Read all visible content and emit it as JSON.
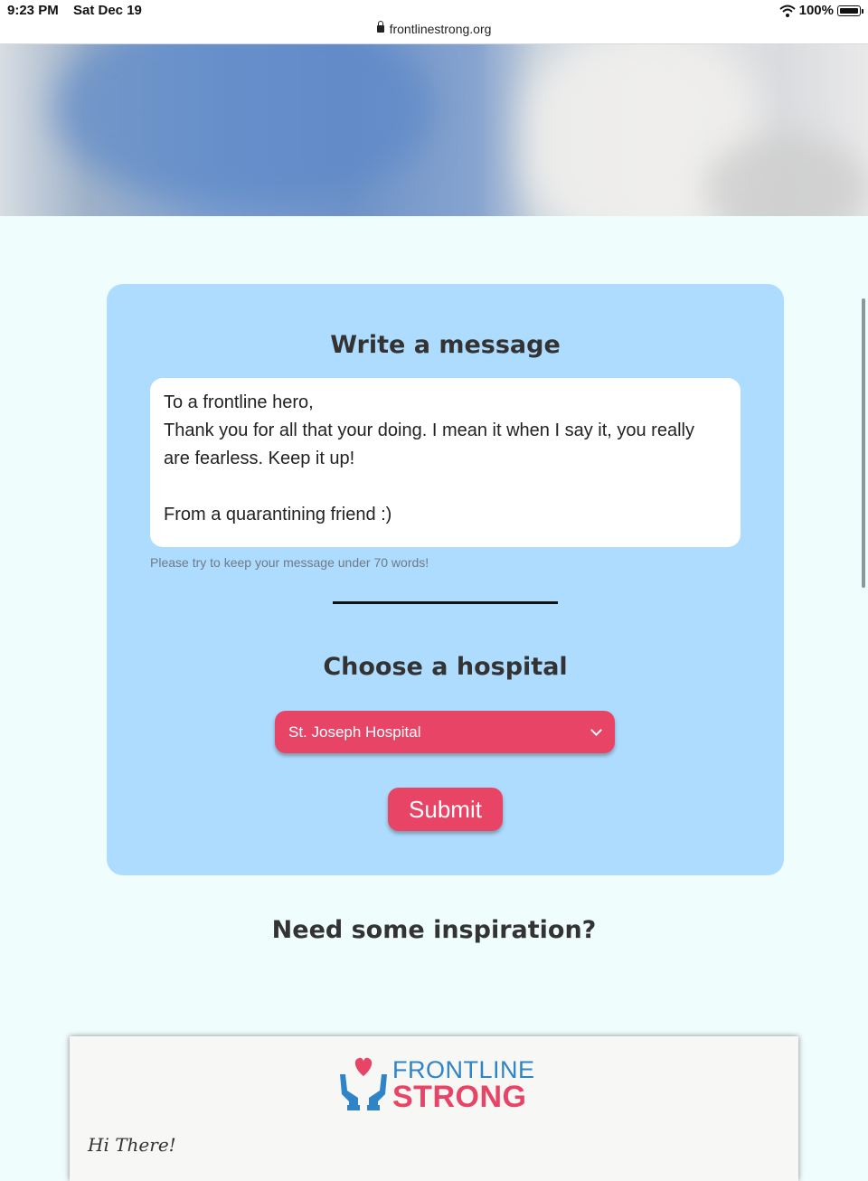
{
  "status_bar": {
    "time": "9:23 PM",
    "date": "Sat Dec 19",
    "url": "frontlinestrong.org",
    "battery": "100%"
  },
  "form": {
    "message_title": "Write a message",
    "message_lines": [
      "To a frontline hero,",
      "Thank you for all that your doing. I mean it when I say it, you really",
      "are fearless. Keep it up!",
      "",
      "From a quarantining friend :)"
    ],
    "hint": "Please try to keep your message under 70 words!",
    "hospital_title": "Choose a hospital",
    "hospital_selected": "St. Joseph Hospital",
    "submit_label": "Submit"
  },
  "inspiration_title": "Need some inspiration?",
  "letter": {
    "logo_line1": "FRONTLINE",
    "logo_line2": "STRONG",
    "greeting": "Hi There!"
  },
  "colors": {
    "page_bg": "#effdfd",
    "card_bg": "#aedcfe",
    "accent": "#e84566",
    "logo_blue": "#2f84c7"
  }
}
